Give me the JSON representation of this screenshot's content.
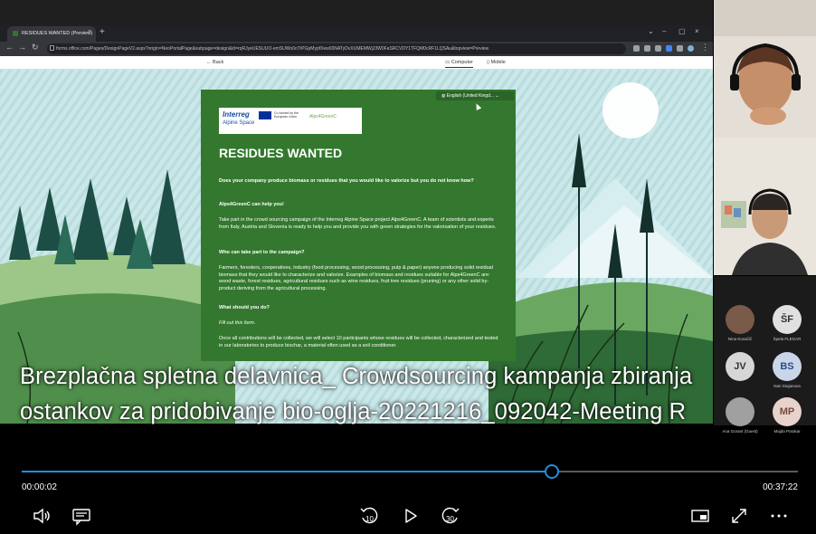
{
  "browser": {
    "tab_title": "RESIDUES WANTED (Preview)",
    "url": "forms.office.com/Pages/DesignPageV2.aspx?origin=NeoPortalPage&subpage=design&id=rqRJyeUESUUO-emSUWo0oTrPGpMypfXew93NATyDvXUMEMWjJ3W0FaSRCVDY1TFQM0cRF1LQSAu&topview=Preview"
  },
  "forms_toolbar": {
    "back_label": "Back",
    "computer_label": "Computer",
    "mobile_label": "Mobile"
  },
  "form": {
    "language": "English (United Kingd...",
    "logo_interreg": "Interreg",
    "logo_alpine": "Alpine Space",
    "logo_cofunded": "Co-funded by the European Union",
    "logo_project": "Alps4GreenC",
    "title": "RESIDUES WANTED",
    "q1": "Does your company produce biomass or residues that you would like to valorize but you do not know how?",
    "h1": "Alps4GreenC can help you!",
    "p1": "Take part in the crowd sourcing campaign of the Interreg Alpine Space project Alps4GreenC. A team of scientists and experts from Italy, Austria and Slovenia is ready to help you and provide you with green strategies for the valorisation of your residues.",
    "h2": "Who can take part to the campaign?",
    "p2": "Farmers, foresters, cooperatives, industry (food processing, wood processing, pulp & paper) anyone producing solid residual biomass that they would like to characterize and valorize. Examples of biomass and residues suitable for Alps4GreenC are: wood waste, forest residues, agricultural residues such as wine residues, fruit tree residues (pruning) or any other solid by-product deriving from the agricultural processing.",
    "h3": "What should you do?",
    "p3": "Fill out this form.",
    "p4": "Once all contributions will be collected, we will select 10 participants whose residues will be collected, characterized and tested in our laboratories to produce biochar, a material often used as a soil conditioner."
  },
  "subtitles": {
    "line1": "Brezplačna spletna delavnica_ Crowdsourcing kampanja zbiranja",
    "line2": "ostankov za pridobivanje bio-oglja-20221216_092042-Meeting R"
  },
  "participants": [
    {
      "initials": "",
      "name": "Nina Kovačič",
      "color": "#7a5a48"
    },
    {
      "initials": "ŠF",
      "name": "Špela FLEGAR",
      "color": "#e0e0e0"
    },
    {
      "initials": "JV",
      "name": "",
      "color": "#d6d6d6"
    },
    {
      "initials": "BS",
      "name": "Nari Stojanova",
      "color": "#c9d6ea"
    },
    {
      "initials": "",
      "name": "Ana Gorant (Guest)",
      "color": "#a0a0a0"
    },
    {
      "initials": "MP",
      "name": "Majda Potokar",
      "color": "#e7d2cc"
    }
  ],
  "player": {
    "current_time": "00:00:02",
    "total_time": "00:37:22",
    "progress": 0.683,
    "skip_back_seconds": "10",
    "skip_forward_seconds": "30",
    "accent_color": "#1f8fe0"
  }
}
